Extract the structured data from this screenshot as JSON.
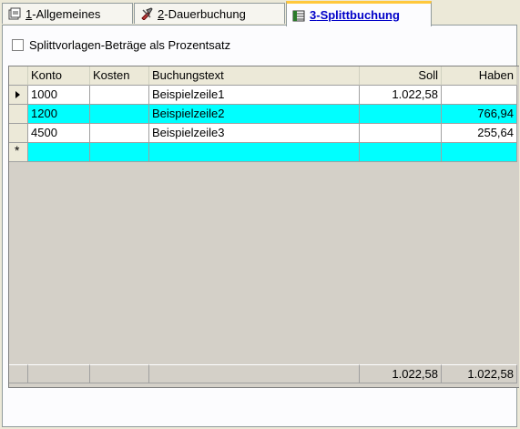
{
  "tabs": [
    {
      "mnemonic": "1",
      "rest": "-Allgemeines",
      "icon": "property-sheet-icon"
    },
    {
      "mnemonic": "2",
      "rest": "-Dauerbuchung",
      "icon": "tools-icon"
    },
    {
      "mnemonic": "3",
      "rest": "-Splittbuchung",
      "icon": "split-sheet-icon",
      "active": true
    }
  ],
  "checkbox": {
    "label": "Splittvorlagen-Beträge als Prozentsatz",
    "checked": false
  },
  "grid": {
    "columns": [
      "Konto",
      "Kosten",
      "Buchungstext",
      "Soll",
      "Haben"
    ],
    "rows": [
      {
        "konto": "1000",
        "kosten": "",
        "text": "Beispielzeile1",
        "soll": "1.022,58",
        "haben": ""
      },
      {
        "konto": "1200",
        "kosten": "",
        "text": "Beispielzeile2",
        "soll": "",
        "haben": "766,94"
      },
      {
        "konto": "4500",
        "kosten": "",
        "text": "Beispielzeile3",
        "soll": "",
        "haben": "255,64"
      }
    ],
    "new_row_marker": "*",
    "totals": {
      "soll": "1.022,58",
      "haben": "1.022,58"
    },
    "highlight_color": "#00FFFF"
  }
}
